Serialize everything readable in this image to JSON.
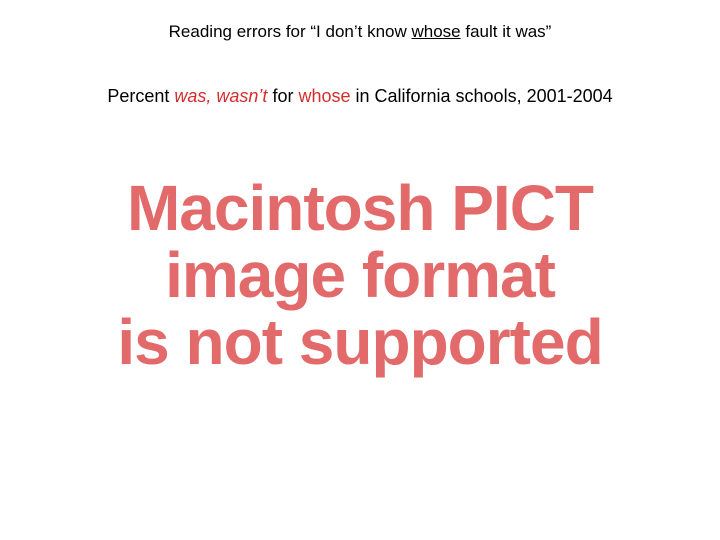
{
  "title": {
    "prefix": "Reading errors for “I don’t know ",
    "underlined": "whose",
    "suffix": " fault it was”"
  },
  "subtitle": {
    "part1": "Percent ",
    "red_italic": "was, wasn’t",
    "part2": " for ",
    "red_word": "whose",
    "part3": " in California schools, 2001-2004"
  },
  "error_message": {
    "line1": "Macintosh PICT",
    "line2": "image format",
    "line3": "is not supported"
  }
}
